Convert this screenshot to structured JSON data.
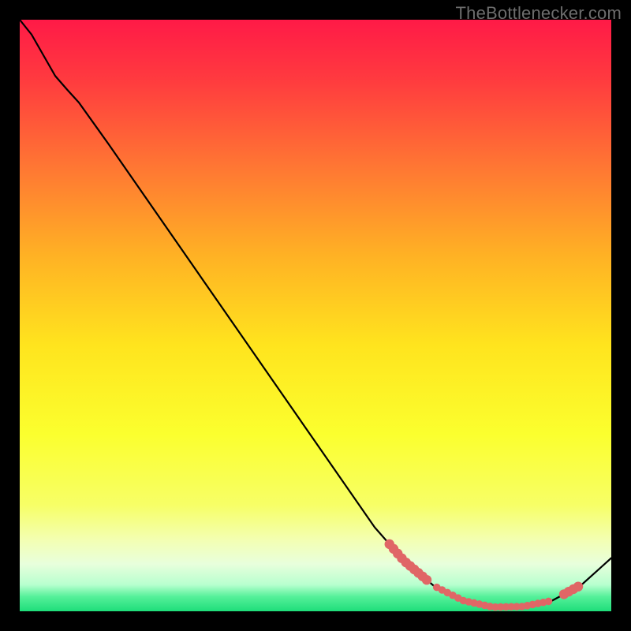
{
  "watermark": "TheBottlenecker.com",
  "chart_data": {
    "type": "line",
    "title": "",
    "xlabel": "",
    "ylabel": "",
    "xlim": [
      0,
      100
    ],
    "ylim": [
      0,
      100
    ],
    "background_gradient_stops": [
      {
        "t": 0.0,
        "color": "#ff1a47"
      },
      {
        "t": 0.1,
        "color": "#ff3a3f"
      },
      {
        "t": 0.25,
        "color": "#ff7733"
      },
      {
        "t": 0.4,
        "color": "#ffb224"
      },
      {
        "t": 0.55,
        "color": "#ffe41e"
      },
      {
        "t": 0.7,
        "color": "#fbff2e"
      },
      {
        "t": 0.82,
        "color": "#f7ff66"
      },
      {
        "t": 0.88,
        "color": "#f3ffb3"
      },
      {
        "t": 0.92,
        "color": "#e8ffdc"
      },
      {
        "t": 0.955,
        "color": "#b8ffcf"
      },
      {
        "t": 0.975,
        "color": "#56f09a"
      },
      {
        "t": 1.0,
        "color": "#1ede7a"
      }
    ],
    "curve": [
      {
        "x": 0.0,
        "y": 100.0
      },
      {
        "x": 2.0,
        "y": 97.5
      },
      {
        "x": 4.0,
        "y": 94.0
      },
      {
        "x": 6.0,
        "y": 90.5
      },
      {
        "x": 8.0,
        "y": 88.2
      },
      {
        "x": 10.0,
        "y": 86.0
      },
      {
        "x": 15.0,
        "y": 79.0
      },
      {
        "x": 20.0,
        "y": 71.8
      },
      {
        "x": 25.0,
        "y": 64.6
      },
      {
        "x": 30.0,
        "y": 57.4
      },
      {
        "x": 35.0,
        "y": 50.2
      },
      {
        "x": 40.0,
        "y": 43.0
      },
      {
        "x": 45.0,
        "y": 35.8
      },
      {
        "x": 50.0,
        "y": 28.6
      },
      {
        "x": 55.0,
        "y": 21.4
      },
      {
        "x": 60.0,
        "y": 14.2
      },
      {
        "x": 65.0,
        "y": 8.5
      },
      {
        "x": 70.0,
        "y": 4.3
      },
      {
        "x": 75.0,
        "y": 1.8
      },
      {
        "x": 80.0,
        "y": 0.7
      },
      {
        "x": 85.0,
        "y": 0.8
      },
      {
        "x": 90.0,
        "y": 1.8
      },
      {
        "x": 95.0,
        "y": 4.5
      },
      {
        "x": 100.0,
        "y": 9.0
      }
    ],
    "highlight_color": "#e06666",
    "highlight_radius_small": 4.8,
    "highlight_radius_large": 6.2,
    "highlight_segments": [
      {
        "from_x": 62.5,
        "to_x": 69.0,
        "step": 0.7,
        "size": "large"
      },
      {
        "from_x": 70.5,
        "to_x": 90.0,
        "step": 0.9,
        "size": "small"
      },
      {
        "from_x": 92.0,
        "to_x": 95.0,
        "step": 0.8,
        "size": "large"
      }
    ]
  }
}
